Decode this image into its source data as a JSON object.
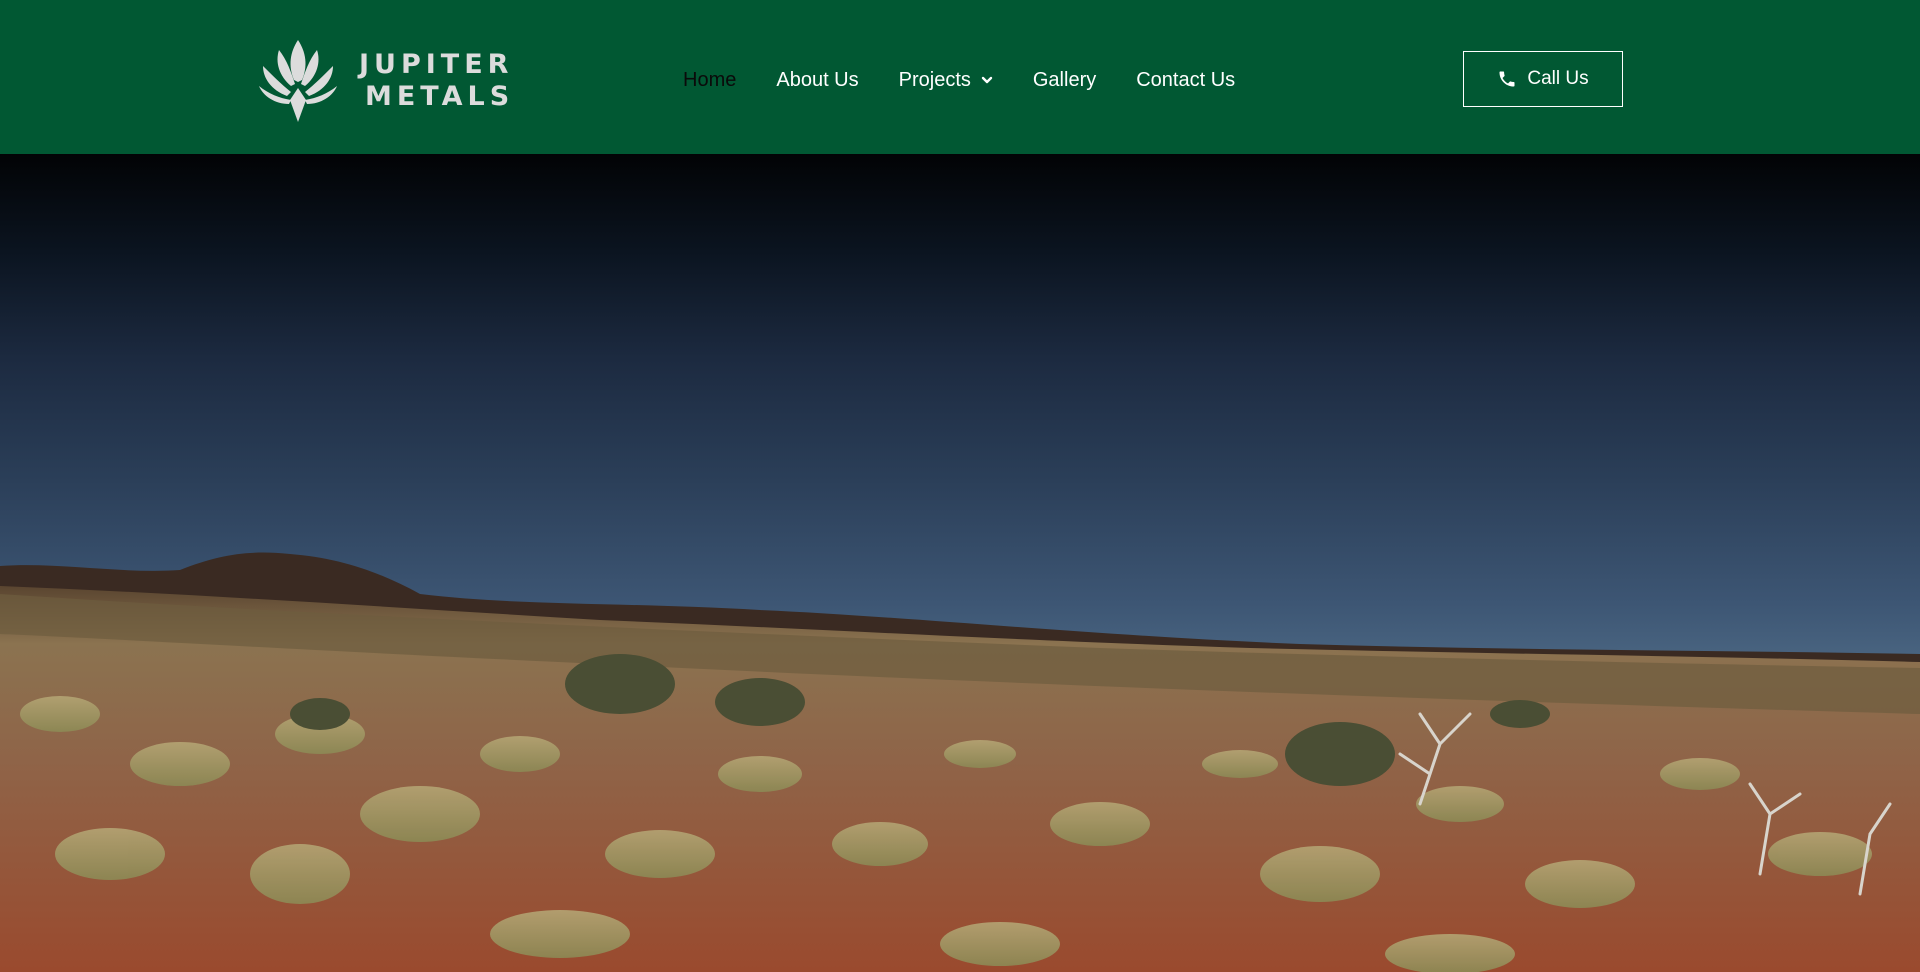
{
  "brand": {
    "line1": "JUPITER",
    "line2": "METALS",
    "logo_icon": "leaf-fan-icon"
  },
  "nav": {
    "items": [
      {
        "label": "Home",
        "active": true
      },
      {
        "label": "About Us",
        "active": false
      },
      {
        "label": "Projects",
        "active": false,
        "has_dropdown": true
      },
      {
        "label": "Gallery",
        "active": false
      },
      {
        "label": "Contact Us",
        "active": false
      }
    ]
  },
  "cta": {
    "label": "Call Us",
    "icon": "phone-icon"
  },
  "colors": {
    "header_bg": "#015833",
    "logo_text": "#dcdcdc",
    "nav_text": "#ffffff",
    "nav_active": "#0a0a0a"
  }
}
